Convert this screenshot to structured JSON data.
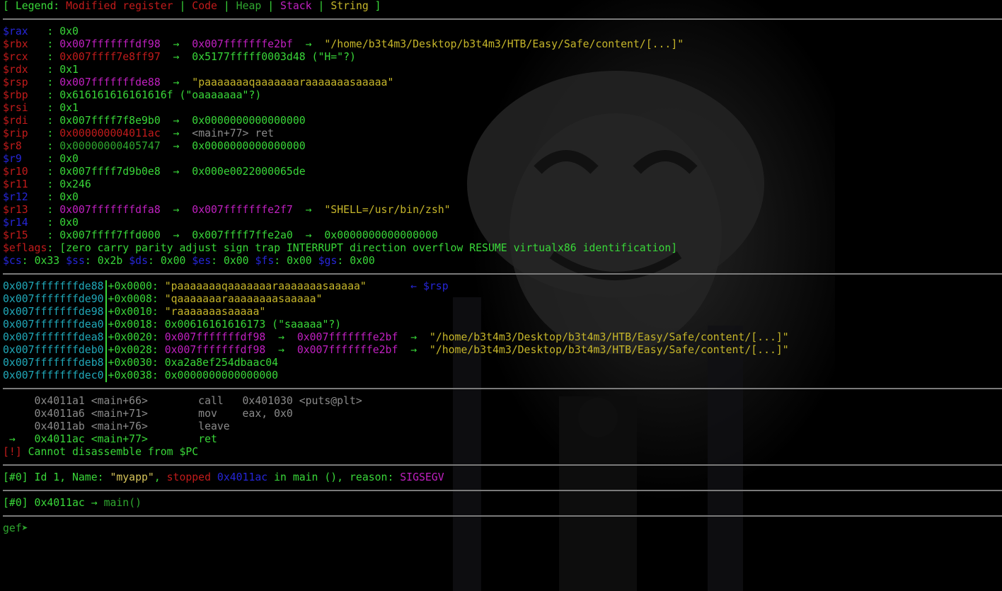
{
  "legend": {
    "open": "[ Legend: ",
    "modified": "Modified register",
    "sep": " | ",
    "code": "Code",
    "heap": "Heap",
    "stack": "Stack",
    "string": "String",
    "close": " ]"
  },
  "registers": {
    "rax": {
      "name": "$rax",
      "pad": "   : ",
      "value": "0x0"
    },
    "rbx": {
      "name": "$rbx",
      "pad": "   : ",
      "v1": "0x007fffffffdf98",
      "arrow": "  →  ",
      "v2": "0x007fffffffe2bf",
      "arrow2": "  →  ",
      "str": "\"/home/b3t4m3/Desktop/b3t4m3/HTB/Easy/Safe/content/[...]\""
    },
    "rcx": {
      "name": "$rcx",
      "pad": "   : ",
      "v1": "0x007ffff7e8ff97",
      "arrow": "  →  ",
      "v2": "0x5177fffff0003d48 (\"H=\"?)"
    },
    "rdx": {
      "name": "$rdx",
      "pad": "   : ",
      "value": "0x1"
    },
    "rsp": {
      "name": "$rsp",
      "pad": "   : ",
      "v1": "0x007fffffffde88",
      "arrow": "  →  ",
      "str": "\"paaaaaaaqaaaaaaaraaaaaaasaaaaa\""
    },
    "rbp": {
      "name": "$rbp",
      "pad": "   : ",
      "value": "0x616161616161616f (\"oaaaaaaa\"?)"
    },
    "rsi": {
      "name": "$rsi",
      "pad": "   : ",
      "value": "0x1"
    },
    "rdi": {
      "name": "$rdi",
      "pad": "   : ",
      "v1": "0x007ffff7f8e9b0",
      "arrow": "  →  ",
      "v2": "0x0000000000000000"
    },
    "rip": {
      "name": "$rip",
      "pad": "   : ",
      "v1": "0x000000004011ac",
      "arrow": "  →  ",
      "v2": "<main+77> ret"
    },
    "r8": {
      "name": "$r8",
      "pad": "    : ",
      "v1": "0x00000000405747",
      "arrow": "  →  ",
      "v2": "0x0000000000000000"
    },
    "r9": {
      "name": "$r9",
      "pad": "    : ",
      "value": "0x0"
    },
    "r10": {
      "name": "$r10",
      "pad": "   : ",
      "v1": "0x007ffff7d9b0e8",
      "arrow": "  →  ",
      "v2": "0x000e0022000065de"
    },
    "r11": {
      "name": "$r11",
      "pad": "   : ",
      "value": "0x246"
    },
    "r12": {
      "name": "$r12",
      "pad": "   : ",
      "value": "0x0"
    },
    "r13": {
      "name": "$r13",
      "pad": "   : ",
      "v1": "0x007fffffffdfa8",
      "arrow": "  →  ",
      "v2": "0x007fffffffe2f7",
      "arrow2": "  →  ",
      "str": "\"SHELL=/usr/bin/zsh\""
    },
    "r14": {
      "name": "$r14",
      "pad": "   : ",
      "value": "0x0"
    },
    "r15": {
      "name": "$r15",
      "pad": "   : ",
      "v1": "0x007ffff7ffd000",
      "arrow": "  →  ",
      "v2": "0x007ffff7ffe2a0",
      "arrow2": "  →  ",
      "v3": "0x0000000000000000"
    },
    "eflags": {
      "name": "$eflags",
      "pad": ": ",
      "value": "[zero carry parity adjust sign trap INTERRUPT direction overflow RESUME virtualx86 identification]"
    }
  },
  "segments": [
    {
      "name": "$cs",
      "value": "0x33"
    },
    {
      "name": "$ss",
      "value": "0x2b"
    },
    {
      "name": "$ds",
      "value": "0x00"
    },
    {
      "name": "$es",
      "value": "0x00"
    },
    {
      "name": "$fs",
      "value": "0x00"
    },
    {
      "name": "$gs",
      "value": "0x00"
    }
  ],
  "stack": [
    {
      "addr": "0x007fffffffde88",
      "off": "+0x0000: ",
      "val": "\"paaaaaaaqaaaaaaaraaaaaaasaaaaa\"",
      "tail": "       ← $rsp"
    },
    {
      "addr": "0x007fffffffde90",
      "off": "+0x0008: ",
      "val": "\"qaaaaaaaraaaaaaaasaaaaa\""
    },
    {
      "addr": "0x007fffffffde98",
      "off": "+0x0010: ",
      "val": "\"raaaaaaasaaaaa\""
    },
    {
      "addr": "0x007fffffffdea0",
      "off": "+0x0018: ",
      "val": "0x00616161616173 (\"saaaaa\"?)"
    },
    {
      "addr": "0x007fffffffdea8",
      "off": "+0x0020: ",
      "p1": "0x007fffffffdf98",
      "a1": "  →  ",
      "p2": "0x007fffffffe2bf",
      "a2": "  →  ",
      "str": "\"/home/b3t4m3/Desktop/b3t4m3/HTB/Easy/Safe/content/[...]\""
    },
    {
      "addr": "0x007fffffffdeb0",
      "off": "+0x0028: ",
      "p1": "0x007fffffffdf98",
      "a1": "  →  ",
      "p2": "0x007fffffffe2bf",
      "a2": "  →  ",
      "str": "\"/home/b3t4m3/Desktop/b3t4m3/HTB/Easy/Safe/content/[...]\""
    },
    {
      "addr": "0x007fffffffdeb8",
      "off": "+0x0030: ",
      "val": "0xa2a8ef254dbaac04"
    },
    {
      "addr": "0x007fffffffdec0",
      "off": "+0x0038: ",
      "val": "0x0000000000000000"
    }
  ],
  "code": [
    {
      "prefix": "     ",
      "line": "0x4011a1 <main+66>        call   0x401030 <puts@plt>"
    },
    {
      "prefix": "     ",
      "line": "0x4011a6 <main+71>        mov    eax, 0x0"
    },
    {
      "prefix": "     ",
      "line": "0x4011ab <main+76>        leave"
    },
    {
      "prefix": " →   ",
      "addr": "0x4011ac",
      "sym": " <main+77>",
      "ins": "        ret"
    }
  ],
  "error": {
    "tag": "[!]",
    "msg": " Cannot disassemble from $PC"
  },
  "threads": {
    "open": "[#0] Id 1, Name: ",
    "name": "\"myapp\"",
    "comma": ", ",
    "stopped": "stopped",
    "addr": " 0x4011ac",
    "rest": " in main (), reason: ",
    "reason": "SIGSEGV"
  },
  "trace": {
    "open": "[#0] ",
    "addr": "0x4011ac",
    "arrow": " → ",
    "fn": "main()"
  },
  "prompt": "gef➤ "
}
